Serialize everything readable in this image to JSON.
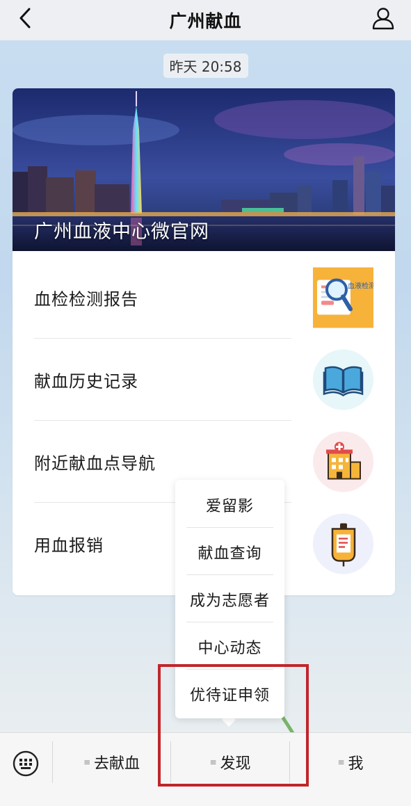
{
  "header": {
    "title": "广州献血",
    "back_icon": "chevron-left-icon",
    "profile_icon": "user-icon"
  },
  "message": {
    "timestamp": "昨天 20:58"
  },
  "card": {
    "banner_title": "广州血液中心微官网",
    "items": [
      {
        "label": "血检检测报告",
        "icon": "blood-test-report-thumb",
        "thumb_text": "血液检测"
      },
      {
        "label": "献血历史记录",
        "icon": "book-icon"
      },
      {
        "label": "附近献血点导航",
        "icon": "hospital-icon"
      },
      {
        "label": "用血报销",
        "icon": "blood-bag-icon"
      }
    ]
  },
  "popup_menu": {
    "items": [
      "爱留影",
      "献血查询",
      "成为志愿者",
      "中心动态",
      "优待证申领"
    ],
    "highlighted_item": "优待证申领"
  },
  "tabbar": {
    "keyboard_icon": "keyboard-icon",
    "tabs": [
      {
        "label": "去献血"
      },
      {
        "label": "发现"
      },
      {
        "label": "我"
      }
    ],
    "menu_mark": "≡"
  },
  "colors": {
    "highlight": "#c0262b",
    "header_bg": "#edeff2",
    "tabbar_bg": "#f6f6f7"
  }
}
